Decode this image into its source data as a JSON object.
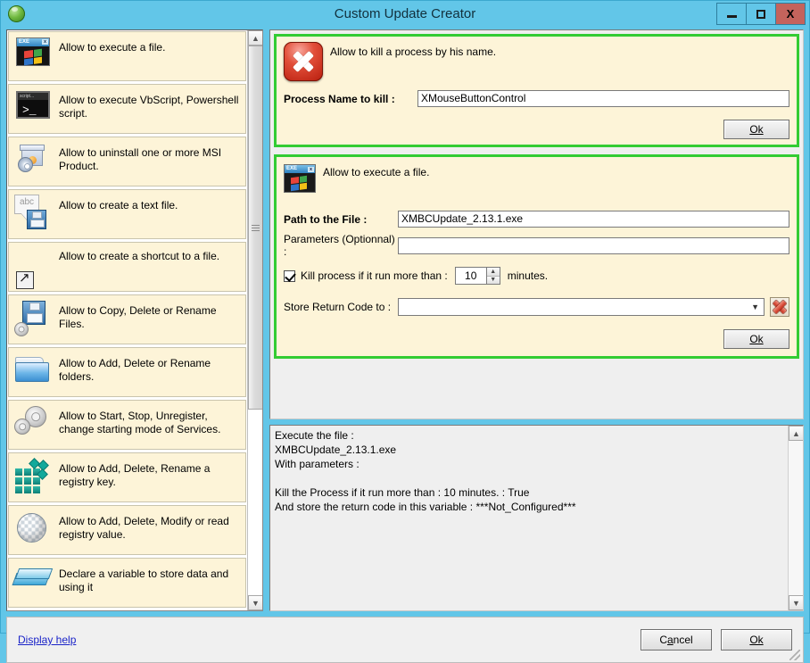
{
  "window": {
    "title": "Custom Update Creator",
    "app_icon": "globe-icon",
    "buttons": {
      "minimize": "minimize-icon",
      "maximize": "maximize-icon",
      "close": "X"
    }
  },
  "action_list": [
    {
      "label": "Allow to execute a file.",
      "icon": "exe-window-icon"
    },
    {
      "label": "Allow to execute VbScript, Powershell script.",
      "icon": "script-console-icon"
    },
    {
      "label": "Allow to uninstall one or more MSI Product.",
      "icon": "msi-package-icon"
    },
    {
      "label": "Allow to create a text file.",
      "icon": "text-file-save-icon"
    },
    {
      "label": "Allow to create a shortcut to a file.",
      "icon": "shortcut-arrow-icon"
    },
    {
      "label": "Allow to Copy, Delete or Rename Files.",
      "icon": "floppy-gear-icon"
    },
    {
      "label": "Allow to Add, Delete or Rename folders.",
      "icon": "folder-icon"
    },
    {
      "label": "Allow to Start, Stop, Unregister, change starting mode of Services.",
      "icon": "gears-icon"
    },
    {
      "label": "Allow to Add, Delete, Rename a registry key.",
      "icon": "registry-key-cube-icon"
    },
    {
      "label": "Allow to Add, Delete, Modify or read registry value.",
      "icon": "registry-value-sphere-icon"
    },
    {
      "label": "Declare a variable to store data and using it",
      "icon": "variable-slab-icon"
    }
  ],
  "kill_process_card": {
    "title": "Allow to kill a process by his name.",
    "icon": "red-x-kill-icon",
    "process_label": "Process Name to kill :",
    "process_value": "XMouseButtonControl",
    "ok_label": "Ok"
  },
  "execute_file_card": {
    "title": "Allow to execute a file.",
    "icon": "exe-window-icon",
    "path_label": "Path to the File :",
    "path_value": "XMBCUpdate_2.13.1.exe",
    "params_label": "Parameters (Optionnal) :",
    "params_value": "",
    "kill_checkbox_label": "Kill process if it run more than :",
    "kill_checkbox_checked": true,
    "minutes_value": "10",
    "minutes_suffix": "minutes.",
    "return_code_label": "Store Return Code to :",
    "return_code_value": "",
    "delete_icon": "red-x-delete-icon",
    "ok_label": "Ok"
  },
  "summary": {
    "text": "Execute the file :\nXMBCUpdate_2.13.1.exe\nWith parameters :\n\nKill the Process if it run more than : 10 minutes. : True\nAnd store the return code in this variable : ***Not_Configured***"
  },
  "footer": {
    "help_link": "Display help",
    "cancel_label": "Cancel",
    "ok_label": "Ok"
  },
  "colors": {
    "window_frame": "#62c6e8",
    "card_border_green": "#33cc33",
    "card_background": "#fdf4d8",
    "link": "#1a23c8",
    "close_button": "#c4635c"
  }
}
